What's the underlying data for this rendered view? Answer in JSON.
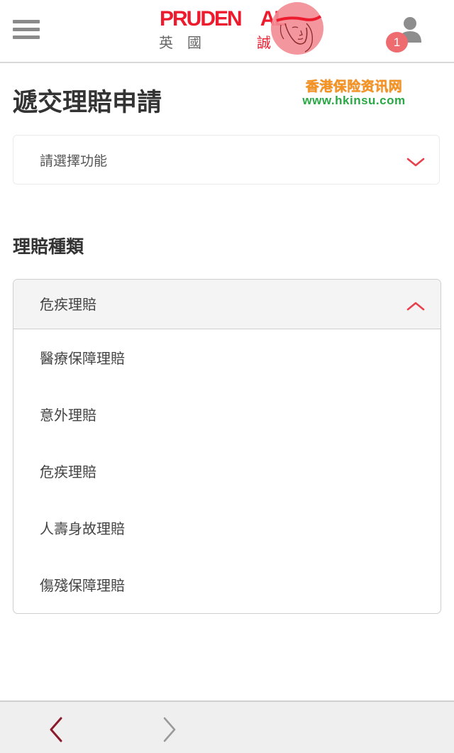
{
  "header": {
    "logo": {
      "brand_left": "PRUDEN",
      "brand_right": "AL",
      "chinese_left": "英國",
      "chinese_right": "誠"
    },
    "notification_count": "1"
  },
  "watermark": {
    "chinese": "香港保险资讯网",
    "url": "www.hkinsu.com"
  },
  "page": {
    "title": "遞交理賠申請",
    "function_select": {
      "label": "請選擇功能"
    },
    "claim_type_heading": "理賠種類",
    "claim_type_dropdown": {
      "selected": "危疾理賠",
      "options": [
        "醫療保障理賠",
        "意外理賠",
        "危疾理賠",
        "人壽身故理賠",
        "傷殘保障理賠"
      ]
    }
  },
  "icons": {
    "menu": "hamburger-menu-icon",
    "user": "user-profile-icon",
    "chevron_down": "chevron-down-icon",
    "chevron_up": "chevron-up-icon",
    "back": "back-arrow-icon",
    "forward": "forward-arrow-icon"
  },
  "colors": {
    "brand_red": "#ed1b2e",
    "badge": "#ee6b70",
    "back_arrow": "#8b1a2b",
    "forward_arrow_disabled": "#9a9a9a",
    "watermark_orange": "#f7931e",
    "watermark_green": "#2aa845"
  }
}
